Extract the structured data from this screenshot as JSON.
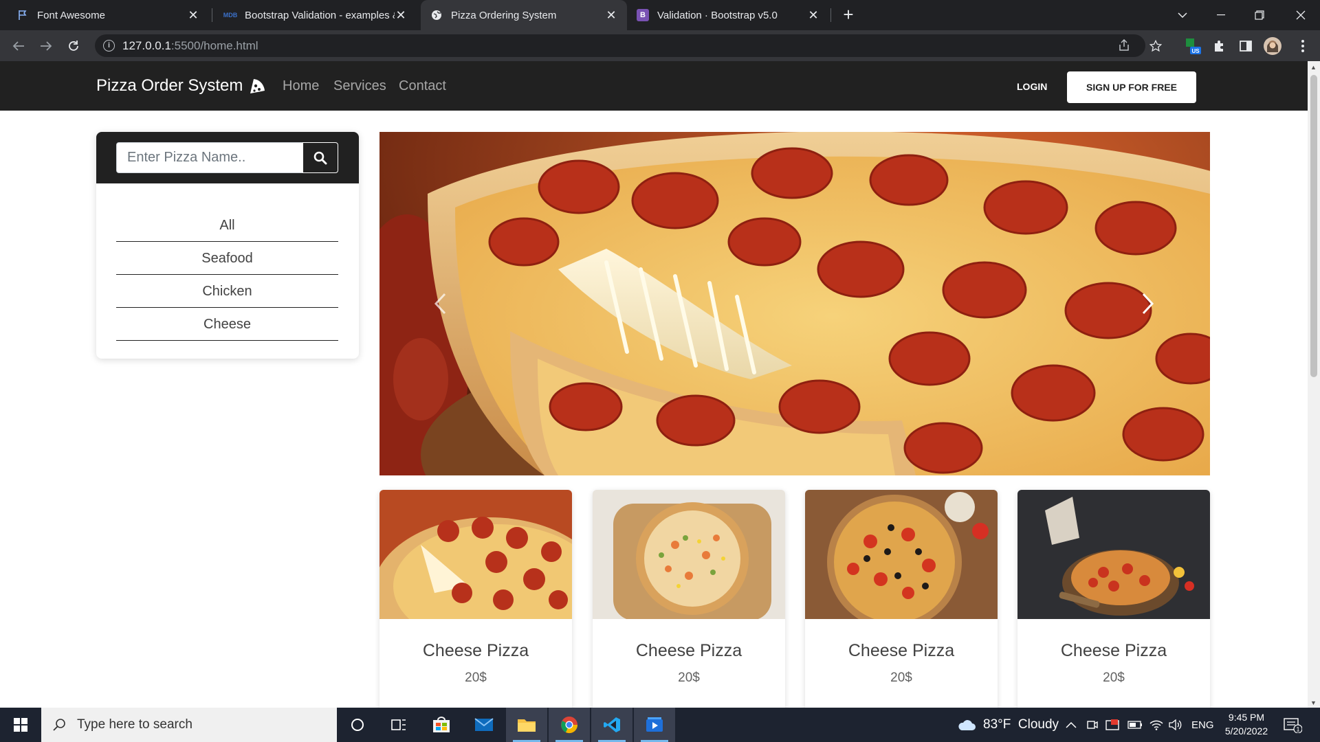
{
  "browser": {
    "tabs": [
      {
        "title": "Font Awesome",
        "favicon": "flag-icon"
      },
      {
        "title": "Bootstrap Validation - examples & tutorial",
        "favicon": "mdb-icon"
      },
      {
        "title": "Pizza Ordering System",
        "favicon": "globe-icon",
        "active": true
      },
      {
        "title": "Validation · Bootstrap v5.0",
        "favicon": "bootstrap-icon"
      }
    ],
    "url_host": "127.0.0.1",
    "url_rest": ":5500/home.html",
    "profile_badge": "US"
  },
  "site": {
    "brand": "Pizza Order System",
    "nav": [
      "Home",
      "Services",
      "Contact"
    ],
    "login": "LOGIN",
    "signup": "SIGN UP FOR FREE"
  },
  "sidebar": {
    "search_placeholder": "Enter Pizza Name..",
    "categories": [
      "All",
      "Seafood",
      "Chicken",
      "Cheese"
    ]
  },
  "cards": [
    {
      "name": "Cheese Pizza",
      "price": "20$"
    },
    {
      "name": "Cheese Pizza",
      "price": "20$"
    },
    {
      "name": "Cheese Pizza",
      "price": "20$"
    },
    {
      "name": "Cheese Pizza",
      "price": "20$"
    }
  ],
  "taskbar": {
    "search_placeholder": "Type here to search",
    "weather": "83°F  Cloudy",
    "lang": "ENG",
    "time": "9:45 PM",
    "date": "5/20/2022",
    "notif_count": "1"
  },
  "colors": {
    "navbar": "#212121",
    "chrome_dark": "#202124",
    "chrome_toolbar": "#35363a",
    "taskbar": "#1d2330"
  }
}
